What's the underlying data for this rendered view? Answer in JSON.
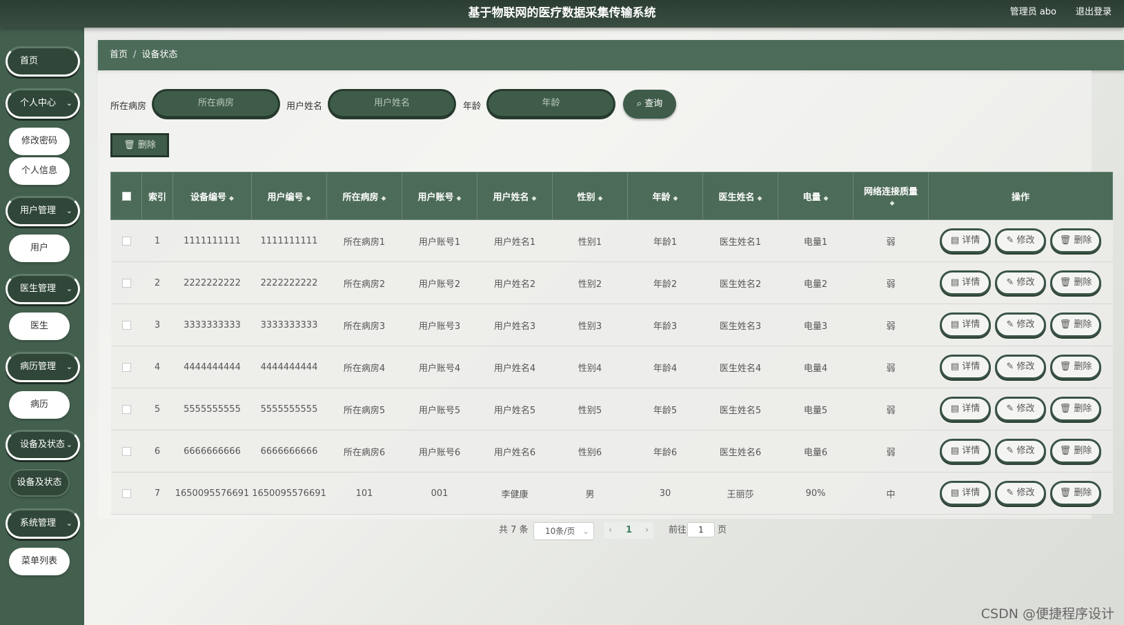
{
  "header": {
    "title": "基于物联网的医疗数据采集传输系统",
    "admin": "管理员 abo",
    "logout": "退出登录"
  },
  "sidebar": {
    "home": "首页",
    "groups": [
      {
        "label": "个人中心",
        "children": [
          "修改密码",
          "个人信息"
        ]
      },
      {
        "label": "用户管理",
        "children": [
          "用户"
        ]
      },
      {
        "label": "医生管理",
        "children": [
          "医生"
        ]
      },
      {
        "label": "病历管理",
        "children": [
          "病历"
        ]
      },
      {
        "label": "设备及状态",
        "children": [
          "设备及状态"
        ]
      },
      {
        "label": "系统管理",
        "children": [
          "菜单列表"
        ]
      }
    ]
  },
  "breadcrumb": {
    "home": "首页",
    "sep": "/",
    "current": "设备状态"
  },
  "search": {
    "ward_label": "所在病房",
    "ward_placeholder": "所在病房",
    "name_label": "用户姓名",
    "name_placeholder": "用户姓名",
    "age_label": "年龄",
    "age_placeholder": "年龄",
    "query_button": "查询"
  },
  "bulk_delete": "删除",
  "table": {
    "columns": [
      "索引",
      "设备编号",
      "用户编号",
      "所在病房",
      "用户账号",
      "用户姓名",
      "性别",
      "年龄",
      "医生姓名",
      "电量",
      "网络连接质量",
      "操作"
    ],
    "rows": [
      [
        "1",
        "1111111111",
        "1111111111",
        "所在病房1",
        "用户账号1",
        "用户姓名1",
        "性别1",
        "年龄1",
        "医生姓名1",
        "电量1",
        "弱"
      ],
      [
        "2",
        "2222222222",
        "2222222222",
        "所在病房2",
        "用户账号2",
        "用户姓名2",
        "性别2",
        "年龄2",
        "医生姓名2",
        "电量2",
        "弱"
      ],
      [
        "3",
        "3333333333",
        "3333333333",
        "所在病房3",
        "用户账号3",
        "用户姓名3",
        "性别3",
        "年龄3",
        "医生姓名3",
        "电量3",
        "弱"
      ],
      [
        "4",
        "4444444444",
        "4444444444",
        "所在病房4",
        "用户账号4",
        "用户姓名4",
        "性别4",
        "年龄4",
        "医生姓名4",
        "电量4",
        "弱"
      ],
      [
        "5",
        "5555555555",
        "5555555555",
        "所在病房5",
        "用户账号5",
        "用户姓名5",
        "性别5",
        "年龄5",
        "医生姓名5",
        "电量5",
        "弱"
      ],
      [
        "6",
        "6666666666",
        "6666666666",
        "所在病房6",
        "用户账号6",
        "用户姓名6",
        "性别6",
        "年龄6",
        "医生姓名6",
        "电量6",
        "弱"
      ],
      [
        "7",
        "1650095576691",
        "1650095576691",
        "101",
        "001",
        "李健康",
        "男",
        "30",
        "王丽莎",
        "90%",
        "中"
      ]
    ],
    "actions": {
      "detail": "详情",
      "edit": "修改",
      "delete": "删除"
    }
  },
  "pagination": {
    "total": "共 7 条",
    "page_size": "10条/页",
    "current_page": "1",
    "goto_label": "前往",
    "goto_value": "1",
    "page_unit": "页"
  },
  "watermark": "CSDN @便捷程序设计"
}
